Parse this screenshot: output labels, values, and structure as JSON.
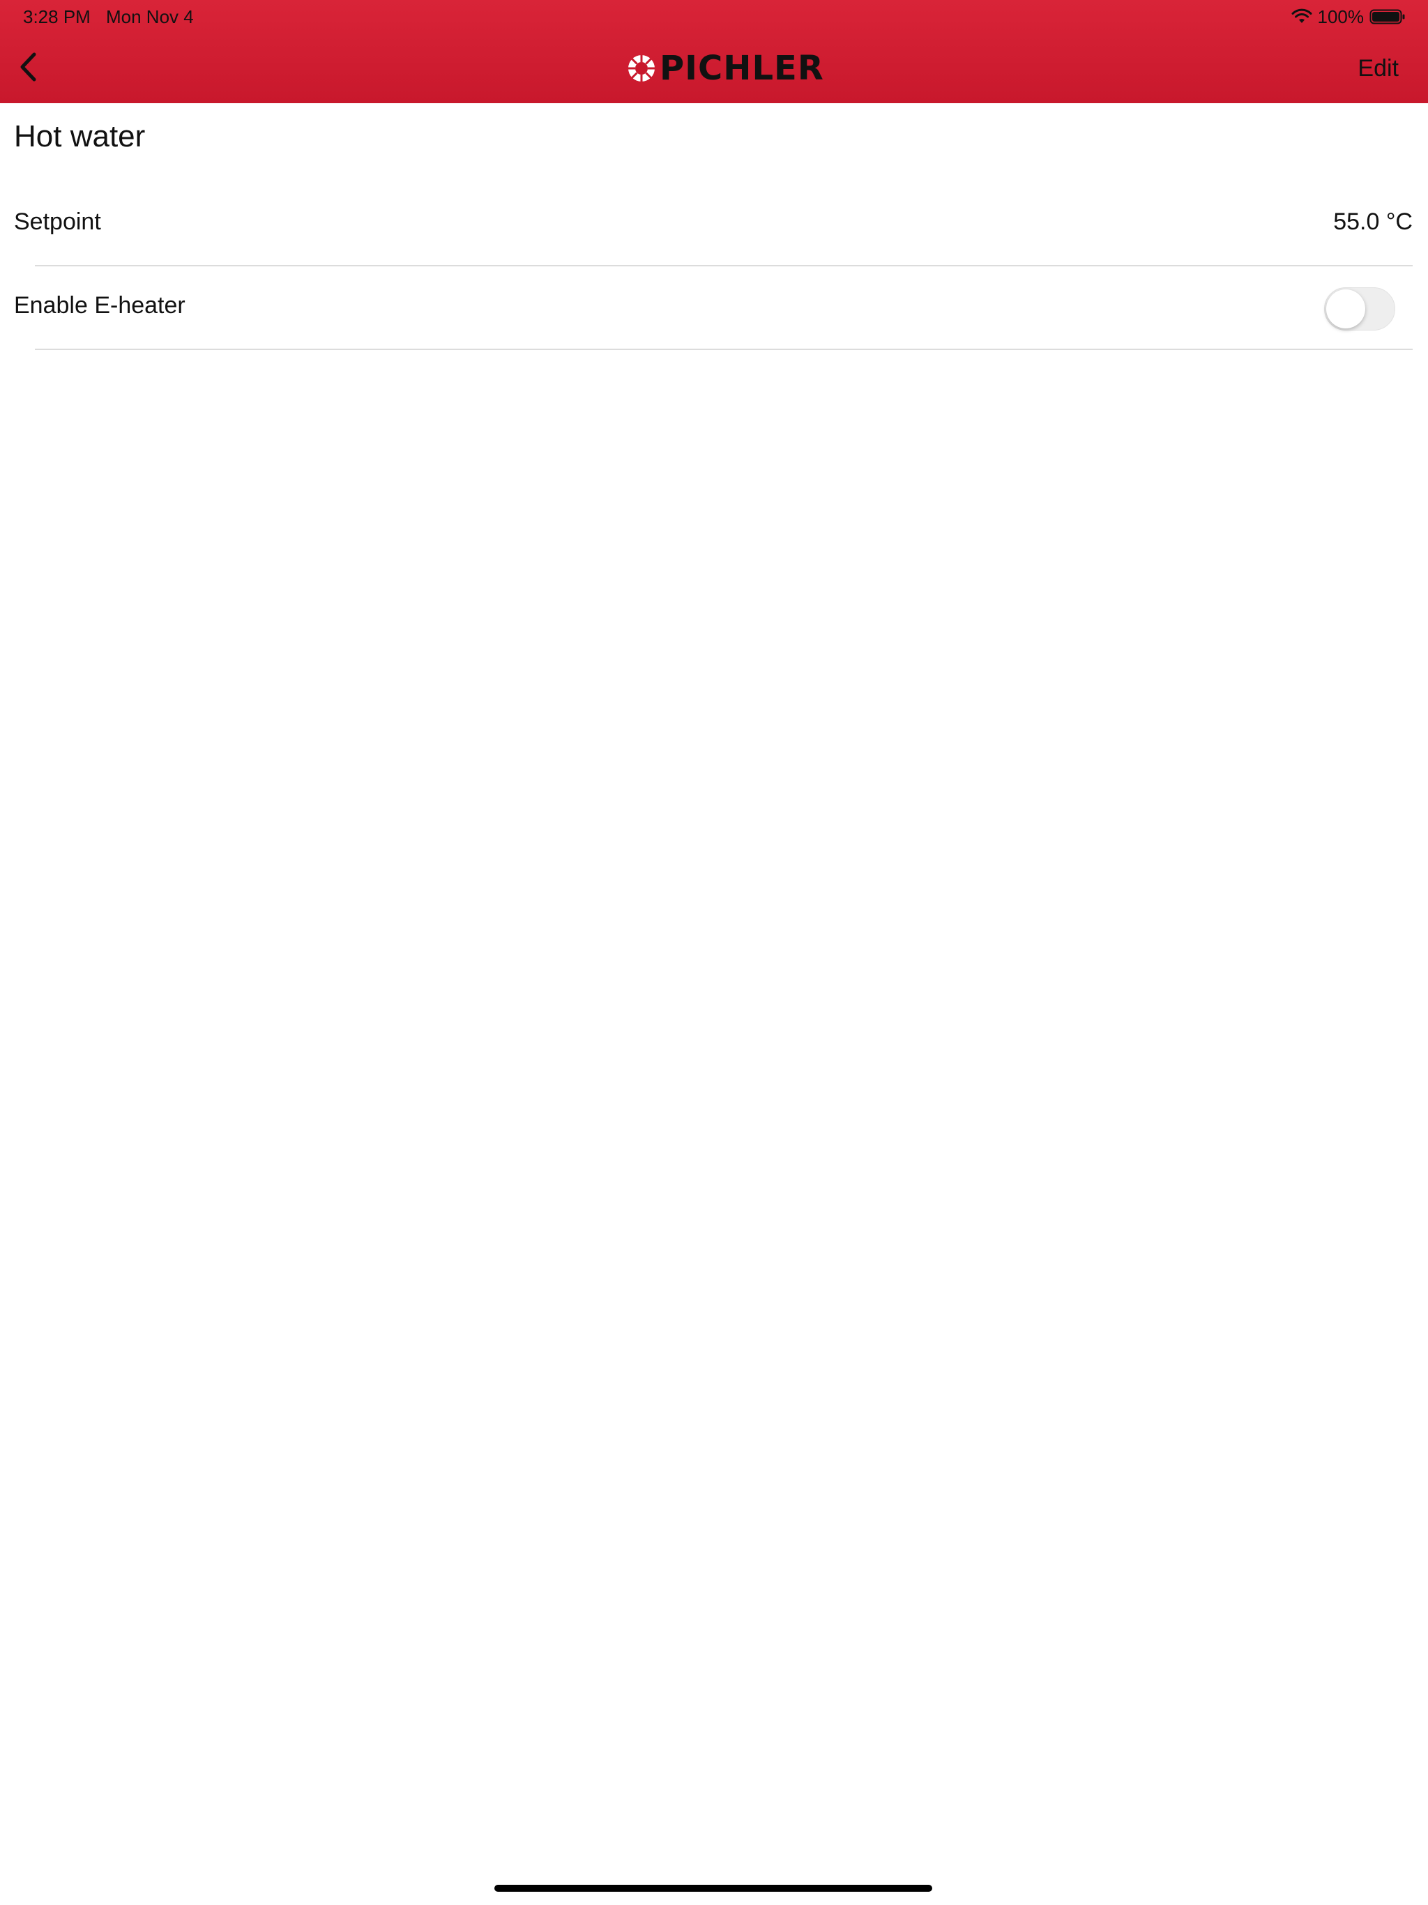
{
  "status_bar": {
    "time": "3:28 PM",
    "date": "Mon Nov 4",
    "battery_percent": "100%",
    "icons": [
      "wifi-icon",
      "battery-icon"
    ]
  },
  "nav_bar": {
    "back_icon": "chevron-left-icon",
    "logo_text": "PICHLER",
    "logo_icon": "pichler-logo-icon",
    "edit_label": "Edit",
    "background_color": "#d0192f"
  },
  "page": {
    "title": "Hot water"
  },
  "settings": {
    "rows": [
      {
        "label": "Setpoint",
        "value": "55.0 °C"
      },
      {
        "label": "Enable E-heater",
        "toggle_on": false
      }
    ]
  }
}
